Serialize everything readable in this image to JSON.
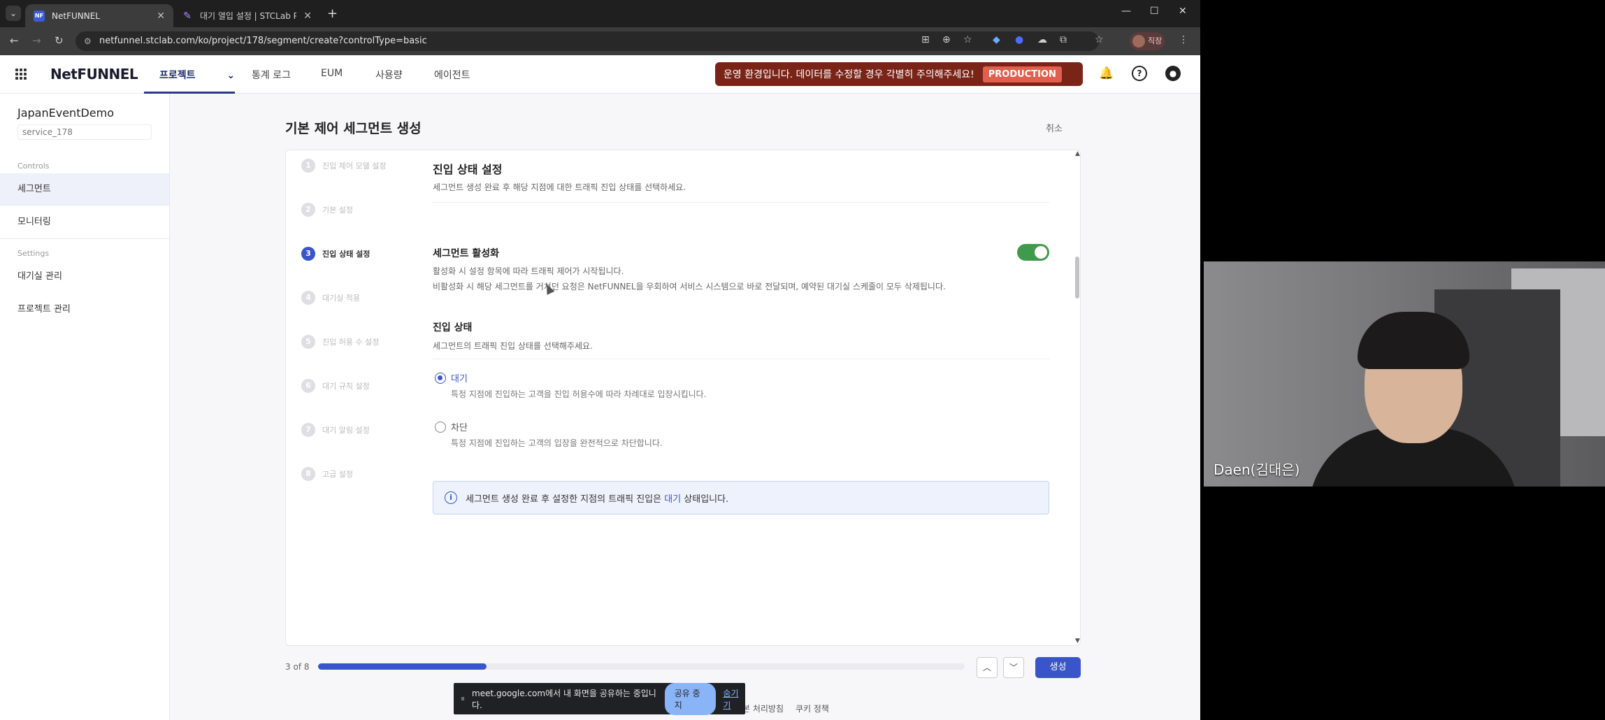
{
  "browser": {
    "tabs": [
      {
        "favicon": "NF",
        "title": "NetFUNNEL",
        "active": true
      },
      {
        "favicon": "stclab-icon",
        "title": "대기 열입 설정 | STCLab Produ",
        "active": false
      }
    ],
    "url": "netfunnel.stclab.com/ko/project/178/segment/create?controlType=basic",
    "profile_label": "직장"
  },
  "app": {
    "logo": "NetFUNNEL",
    "nav": [
      {
        "label": "프로젝트",
        "active": true
      },
      {
        "label": "통계 로그"
      },
      {
        "label": "EUM"
      },
      {
        "label": "사용량"
      },
      {
        "label": "에이전트"
      }
    ],
    "warning": "운영 환경입니다. 데이터를 수정할 경우 각별히 주의해주세요!",
    "env_badge": "PRODUCTION"
  },
  "sidebar": {
    "project_name": "JapanEventDemo",
    "service_id": "service_178",
    "controls_label": "Controls",
    "settings_label": "Settings",
    "items": [
      {
        "label": "세그먼트",
        "active": true
      },
      {
        "label": "모니터링"
      },
      {
        "label": "대기실 관리"
      },
      {
        "label": "프로젝트 관리"
      }
    ]
  },
  "page": {
    "title": "기본 제어 세그먼트 생성",
    "cancel": "취소",
    "steps": [
      {
        "num": "1",
        "label": "진입 제어 모델 설정"
      },
      {
        "num": "2",
        "label": "기본 설정"
      },
      {
        "num": "3",
        "label": "진입 상태 설정",
        "active": true
      },
      {
        "num": "4",
        "label": "대기실 적용"
      },
      {
        "num": "5",
        "label": "진입 허용 수 설정"
      },
      {
        "num": "6",
        "label": "대기 규칙 설정"
      },
      {
        "num": "7",
        "label": "대기 알림 설정"
      },
      {
        "num": "8",
        "label": "고급 설정"
      }
    ],
    "section": {
      "title": "진입 상태 설정",
      "desc": "세그먼트 생성 완료 후 해당 지점에 대한 트래픽 진입 상태를 선택하세요."
    },
    "activation": {
      "title": "세그먼트 활성화",
      "desc1": "활성화 시 설정 항목에 따라 트래픽 제어가 시작됩니다.",
      "desc2": "비활성화 시 해당 세그먼트를 거쳐던 요청은 NetFUNNEL을 우회하여 서비스 시스템으로 바로 전달되며, 예약된 대기실 스케줄이 모두 삭제됩니다.",
      "enabled": true
    },
    "entry": {
      "title": "진입 상태",
      "desc": "세그먼트의 트래픽 진입 상태를 선택해주세요.",
      "options": [
        {
          "label": "대기",
          "desc": "특정 지점에 진입하는 고객을 진입 허용수에 따라 차례대로 입장시킵니다.",
          "selected": true
        },
        {
          "label": "차단",
          "desc": "특정 지점에 진입하는 고객의 입장을 완전적으로 차단합니다.",
          "selected": false
        }
      ]
    },
    "info": {
      "before": "세그먼트 생성 완료 후 설정한 지점의 트래픽 진입은",
      "highlight": "대기",
      "after": "상태입니다."
    },
    "progress_label": "3 of 8",
    "progress": 0.26,
    "create": "생성"
  },
  "share_bar": {
    "text": "meet.google.com에서 내 화면을 공유하는 중입니다.",
    "stop": "공유 중지",
    "hide": "숨기기"
  },
  "footer": {
    "privacy": "본 처리방침",
    "cookie": "쿠키 정책"
  },
  "video": {
    "name": "Daen(김대은)"
  }
}
